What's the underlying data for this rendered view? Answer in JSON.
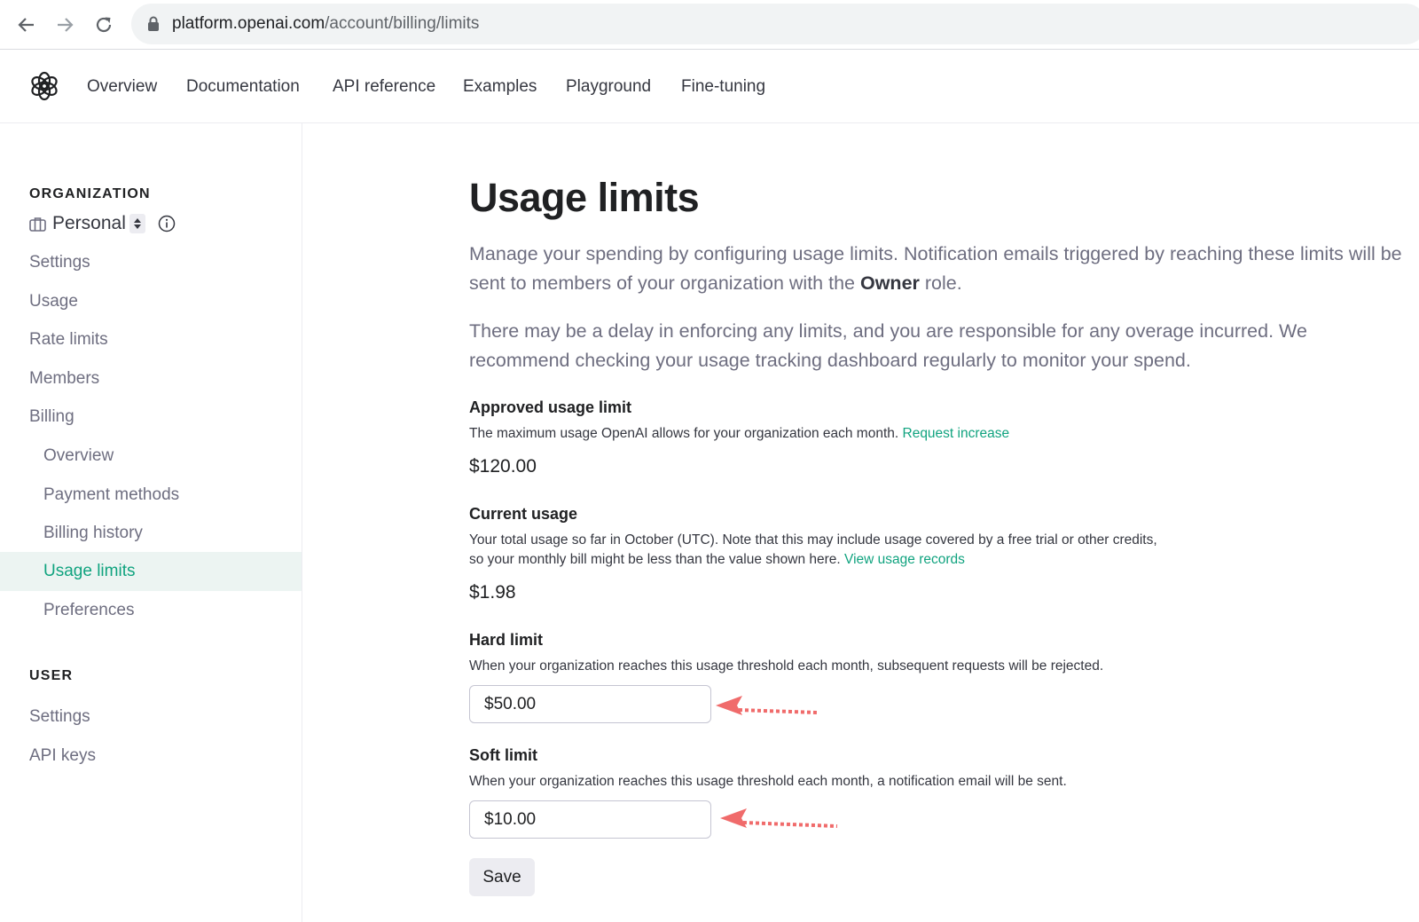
{
  "browser": {
    "url_host": "platform.openai.com",
    "url_path": "/account/billing/limits"
  },
  "topnav": {
    "items": [
      "Overview",
      "Documentation",
      "API reference",
      "Examples",
      "Playground",
      "Fine-tuning"
    ]
  },
  "sidebar": {
    "organization_label": "ORGANIZATION",
    "org_name": "Personal",
    "org_items": [
      "Settings",
      "Usage",
      "Rate limits",
      "Members",
      "Billing"
    ],
    "billing_items": [
      "Overview",
      "Payment methods",
      "Billing history",
      "Usage limits",
      "Preferences"
    ],
    "active_item": "Usage limits",
    "user_label": "USER",
    "user_items": [
      "Settings",
      "API keys"
    ]
  },
  "main": {
    "title": "Usage limits",
    "intro1_before": "Manage your spending by configuring usage limits. Notification emails triggered by reaching these limits will be sent to members of your organization with the ",
    "intro1_bold": "Owner",
    "intro1_after": " role.",
    "intro2": "There may be a delay in enforcing any limits, and you are responsible for any overage incurred. We recommend checking your usage tracking dashboard regularly to monitor your spend.",
    "approved": {
      "title": "Approved usage limit",
      "desc": "The maximum usage OpenAI allows for your organization each month.",
      "link": "Request increase",
      "amount": "$120.00"
    },
    "current": {
      "title": "Current usage",
      "desc_line1": "Your total usage so far in October (UTC). Note that this may include usage covered by a free trial or other credits,",
      "desc_line2": "so your monthly bill might be less than the value shown here.",
      "link": "View usage records",
      "amount": "$1.98"
    },
    "hard": {
      "title": "Hard limit",
      "desc": "When your organization reaches this usage threshold each month, subsequent requests will be rejected.",
      "value": "$50.00"
    },
    "soft": {
      "title": "Soft limit",
      "desc": "When your organization reaches this usage threshold each month, a notification email will be sent.",
      "value": "$10.00"
    },
    "save_label": "Save"
  },
  "colors": {
    "accent": "#10a37f",
    "active_bg": "#ecf4f2",
    "annotation_arrow": "#f06b6b"
  }
}
